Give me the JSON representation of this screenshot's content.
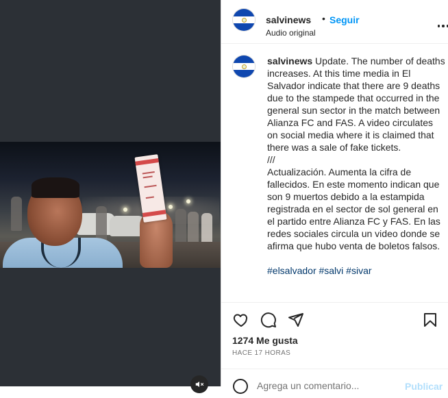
{
  "header": {
    "username": "salvinews",
    "separator": "•",
    "follow_label": "Seguir",
    "audio_label": "Audio original"
  },
  "caption": {
    "username": "salvinews",
    "text": " Update. The number of deaths increases. At this time media in El Salvador indicate that there are 9 deaths due to the stampede that occurred in the general sun sector in the match between Alianza FC and FAS. A video circulates on social media where it is claimed that there was a sale of fake tickets.\n///\nActualización. Aumenta la cifra de fallecidos. En este momento indican que son 9 muertos debido a la estampida registrada en el sector de sol general en el partido entre Alianza FC y FAS. En las redes sociales circula un video donde se afirma que hubo venta de boletos falsos.",
    "hashtags": "#elsalvador #salvi #sivar"
  },
  "stats": {
    "likes": "1274 Me gusta",
    "time_ago": "HACE 17 HORAS"
  },
  "comment": {
    "placeholder": "Agrega un comentario...",
    "publish_label": "Publicar"
  },
  "icons": {
    "more": "more-options-icon",
    "like": "heart-icon",
    "comment": "comment-icon",
    "share": "share-icon",
    "save": "bookmark-icon",
    "mute": "muted-speaker-icon",
    "emoji": "emoji-icon"
  },
  "colors": {
    "link_blue": "#0095f6",
    "hashtag_blue": "#00376b",
    "media_background": "#2c3036",
    "flag_blue": "#0f47af"
  }
}
